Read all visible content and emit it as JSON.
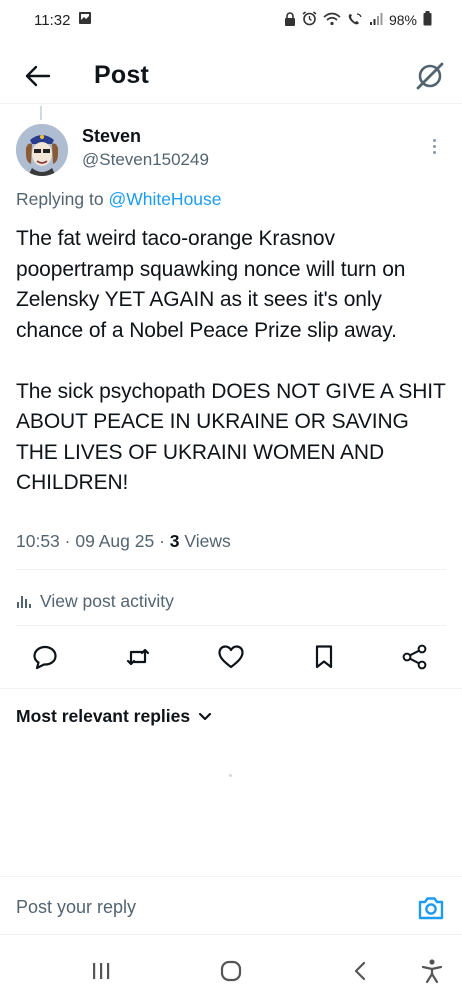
{
  "status_bar": {
    "time": "11:32",
    "battery": "98%",
    "icons": [
      "gallery-icon",
      "lock-icon",
      "alarm-icon",
      "wifi-icon",
      "wifi-calling-icon",
      "signal-icon",
      "battery-icon"
    ]
  },
  "header": {
    "title": "Post",
    "back_icon": "arrow-left-icon",
    "grok_icon": "grok-icon"
  },
  "post": {
    "author_name": "Steven",
    "author_handle": "@Steven150249",
    "replying_prefix": "Replying to",
    "replying_to": "@WhiteHouse",
    "paragraphs": [
      "The fat weird taco-orange Krasnov poopertramp squawking nonce will turn on Zelensky YET AGAIN as it sees it's only chance of a Nobel Peace Prize slip away.",
      "The sick psychopath DOES NOT GIVE A SHIT ABOUT PEACE IN UKRAINE OR SAVING THE LIVES OF UKRAINI WOMEN AND CHILDREN!"
    ],
    "time": "10:53",
    "date": "09 Aug 25",
    "views_count": "3",
    "views_label": "Views",
    "sep": "·"
  },
  "activity": {
    "label": "View post activity",
    "icon": "analytics-icon"
  },
  "actions": [
    "reply-icon",
    "repost-icon",
    "like-icon",
    "bookmark-icon",
    "share-icon"
  ],
  "replies": {
    "sort_label": "Most relevant replies",
    "chevron": "chevron-down-icon"
  },
  "reply_bar": {
    "placeholder": "Post your reply",
    "camera_icon": "camera-icon"
  },
  "nav": [
    "recents-icon",
    "home-icon",
    "back-icon",
    "accessibility-icon"
  ],
  "colors": {
    "accent": "#1d9bf0",
    "text": "#0f1419",
    "muted": "#536471",
    "divider": "#eff3f4"
  }
}
